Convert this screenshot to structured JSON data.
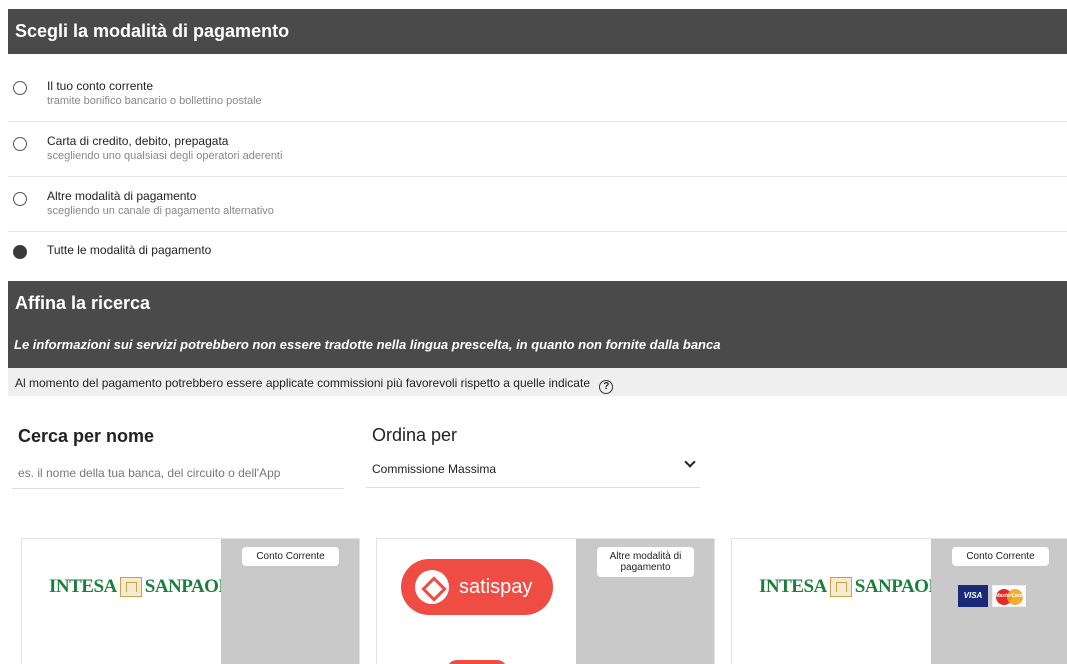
{
  "payment_section": {
    "title": "Scegli la modalità di pagamento",
    "options": [
      {
        "label": "Il tuo conto corrente",
        "sub": "tramite bonifico bancario o bollettino postale",
        "checked": false
      },
      {
        "label": "Carta di credito, debito, prepagata",
        "sub": "scegliendo uno qualsiasi degli operatori aderenti",
        "checked": false
      },
      {
        "label": "Altre modalità di pagamento",
        "sub": "scegliendo un canale di pagamento alternativo",
        "checked": false
      },
      {
        "label": "Tutte le modalità di pagamento",
        "sub": "",
        "checked": true
      }
    ]
  },
  "refine_section": {
    "title": "Affina la ricerca",
    "note": "Le informazioni sui servizi potrebbero non essere tradotte nella lingua prescelta, in quanto non fornite dalla banca"
  },
  "infobar": {
    "text": "Al momento del pagamento potrebbero essere applicate commissioni più favorevoli rispetto a quelle indicate",
    "help_icon": "?"
  },
  "search": {
    "title": "Cerca per nome",
    "placeholder": "es. il nome della tua banca, del circuito o dell'App"
  },
  "sort": {
    "title": "Ordina per",
    "selected": "Commissione Massima"
  },
  "cards": [
    {
      "provider_logo": "INTESA SANPAOLO",
      "logo_left": "INTESA",
      "logo_right": "SANPAOLO",
      "tag": "Conto Corrente"
    },
    {
      "provider_logo": "satispay",
      "logo_text": "satispay",
      "tag": "Altre modalità di pagamento"
    },
    {
      "provider_logo": "INTESA SANPAOLO",
      "logo_left": "INTESA",
      "logo_right": "SANPAOLO",
      "tag": "Conto Corrente",
      "card_logos": [
        "VISA",
        "MasterCard"
      ]
    }
  ],
  "colors": {
    "header_bg": "#4a4a4a",
    "infobar_bg": "#efefef",
    "card_side_bg": "#c9c9c9",
    "intesa_green": "#1a7f3a",
    "satispay_red": "#ef4c44"
  }
}
